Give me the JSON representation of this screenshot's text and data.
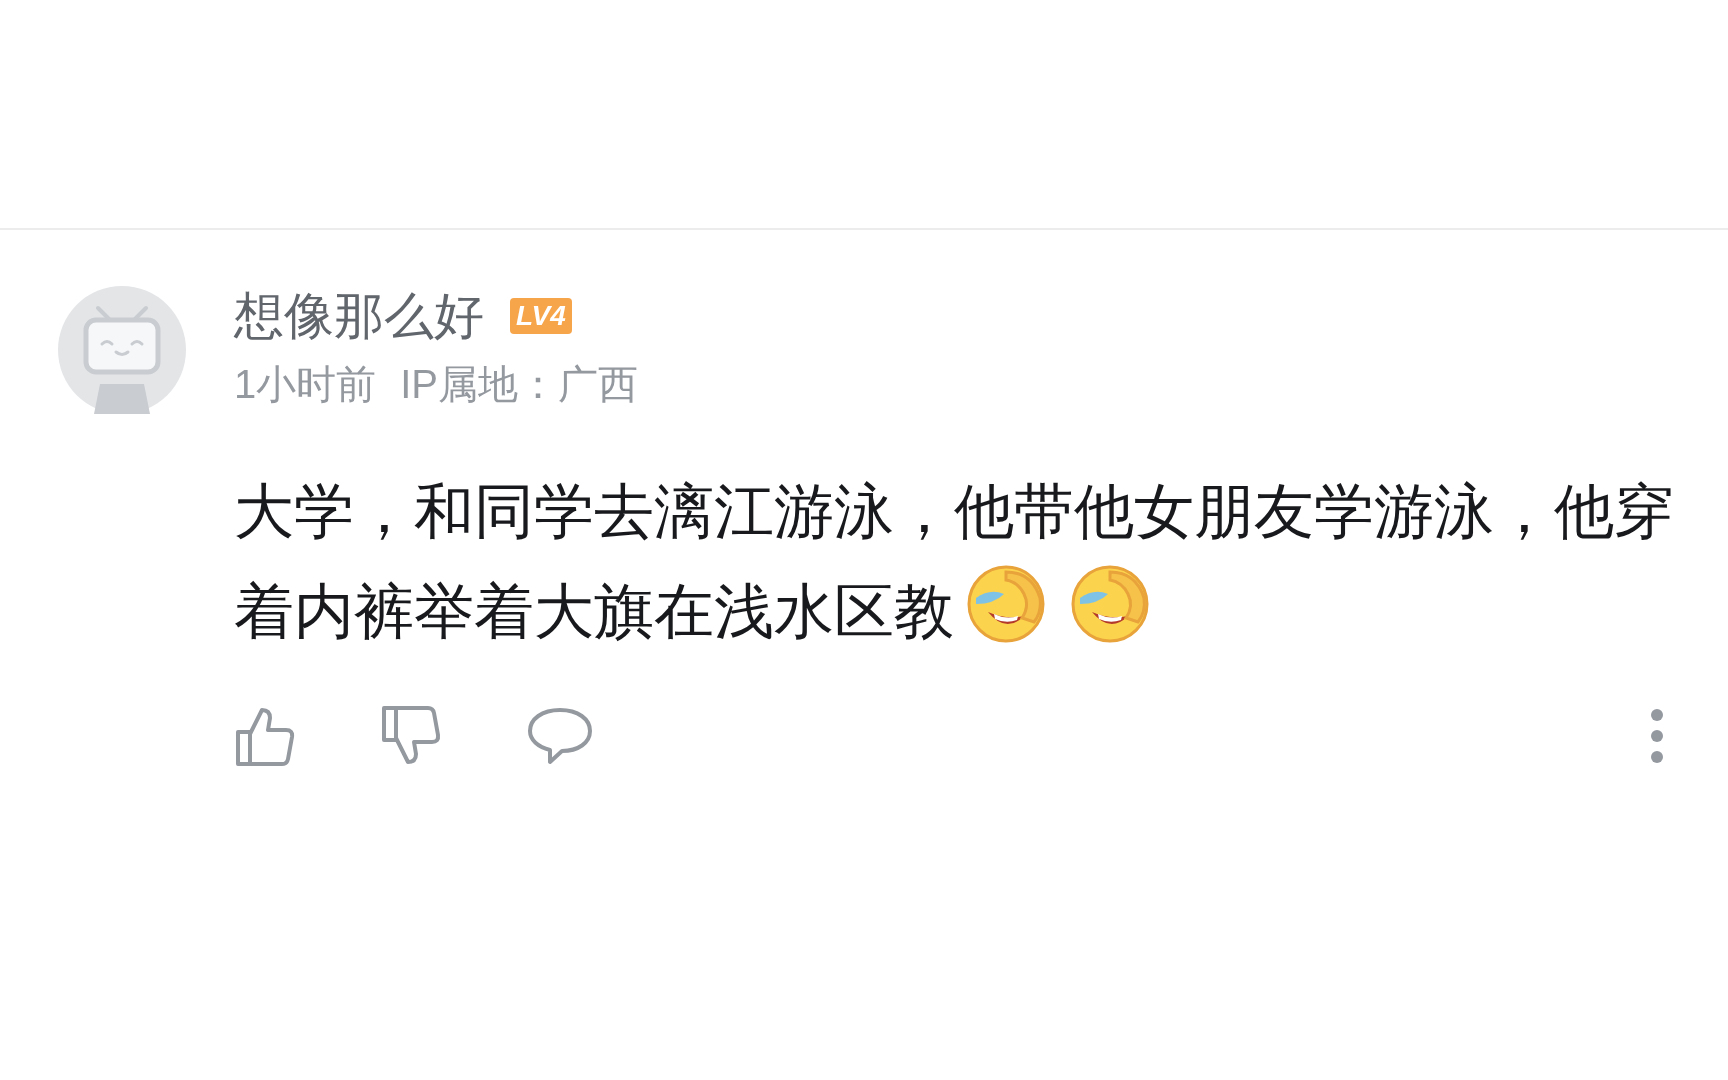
{
  "comment": {
    "username": "想像那么好",
    "level_badge": "LV4",
    "time": "1小时前",
    "ip_location": "IP属地：广西",
    "body": [
      {
        "kind": "text",
        "text": "大学，和同学去漓江游泳，他带他女朋友学游泳，他穿着内裤举着大旗在浅水区教"
      },
      {
        "kind": "emoji"
      },
      {
        "kind": "emoji"
      }
    ]
  }
}
